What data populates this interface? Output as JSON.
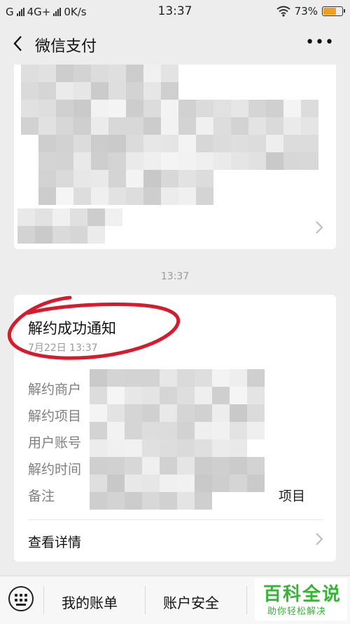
{
  "status_bar": {
    "carrier_left": "G",
    "network": "4G+",
    "speed": "0K/s",
    "time": "13:37",
    "battery": "73%",
    "battery_level": 0.73,
    "battery_color": "#f0a020"
  },
  "nav": {
    "title": "微信支付",
    "more": "•••",
    "back_icon": "chevron-left-icon",
    "more_icon": "ellipsis-icon"
  },
  "chat": {
    "timestamp": "13:37"
  },
  "notification": {
    "title": "解约成功通知",
    "date": "7月22日  13:37",
    "rows": [
      {
        "label": "解约商户",
        "value": ""
      },
      {
        "label": "解约项目",
        "value": ""
      },
      {
        "label": "用户账号",
        "value": ""
      },
      {
        "label": "解约时间",
        "value": ""
      },
      {
        "label": "备注",
        "value": "项目"
      }
    ],
    "detail_label": "查看详情",
    "annotation_color": "#d61c2c"
  },
  "bottom_menu": {
    "keyboard_icon": "keyboard-icon",
    "items": [
      "我的账单",
      "账户安全",
      ""
    ]
  },
  "watermark": {
    "brand": "百科全说",
    "slogan": "助你轻松解决",
    "color": "#36b535"
  }
}
